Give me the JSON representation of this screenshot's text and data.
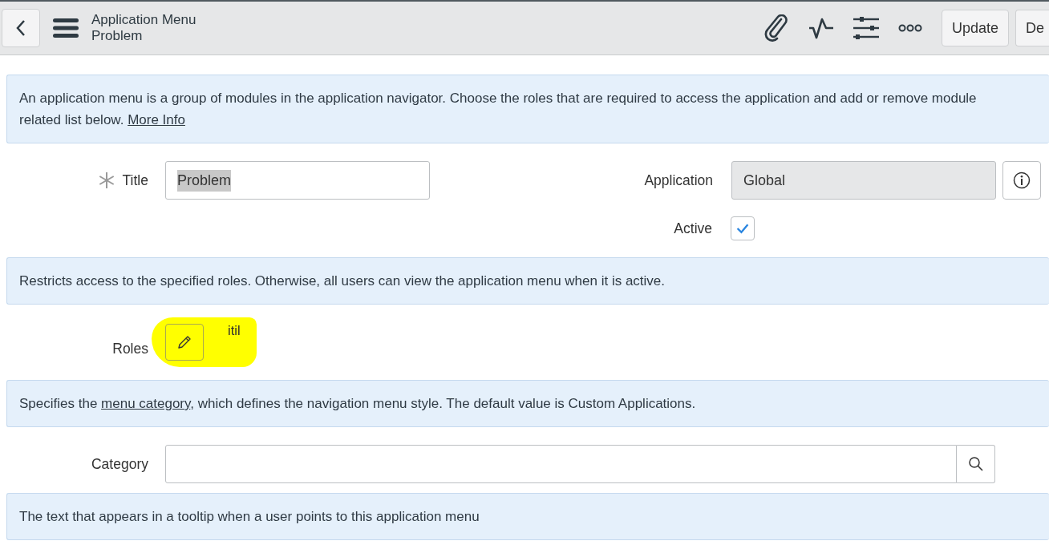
{
  "header": {
    "title": "Application Menu",
    "subtitle": "Problem",
    "buttons": [
      "Update",
      "De"
    ]
  },
  "intro": {
    "text": "An application menu is a group of modules in the application navigator. Choose the roles that are required to access the application and add or remove module\nrelated list below.",
    "link": "More Info"
  },
  "title_field": {
    "label": "Title",
    "required": true,
    "value": "Problem",
    "value_selected": true
  },
  "application_field": {
    "label": "Application",
    "value": "Global",
    "readonly": true
  },
  "active": {
    "label": "Active",
    "checked": true
  },
  "roles_note": {
    "text": "Restricts access to the specified roles. Otherwise, all users can view the application menu when it is active."
  },
  "roles": {
    "label": "Roles",
    "value": "itil",
    "highlighted": true
  },
  "category_note": {
    "before": "Specifies the ",
    "link": "menu category",
    "after": ", which defines the navigation menu style. The default value is Custom Applications."
  },
  "category": {
    "label": "Category"
  },
  "hint_note": {
    "text": "The text that appears in a tooltip when a user points to this application menu"
  }
}
